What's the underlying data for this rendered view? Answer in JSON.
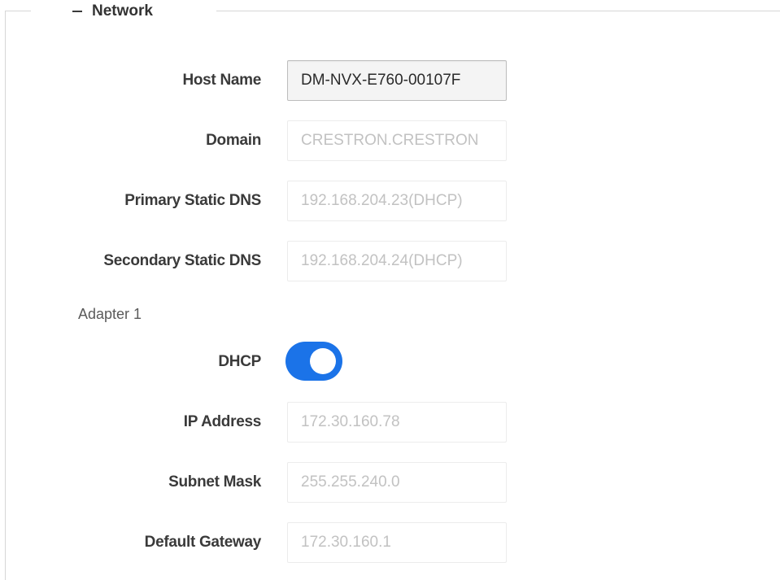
{
  "section": {
    "title": "Network",
    "collapse_icon": "minus-icon"
  },
  "fields": {
    "host_name": {
      "label": "Host Name",
      "value": "DM-NVX-E760-00107F"
    },
    "domain": {
      "label": "Domain",
      "value": "CRESTRON.CRESTRON"
    },
    "primary_dns": {
      "label": "Primary Static DNS",
      "value": "192.168.204.23(DHCP)"
    },
    "secondary_dns": {
      "label": "Secondary Static DNS",
      "value": "192.168.204.24(DHCP)"
    }
  },
  "adapter": {
    "title": "Adapter 1",
    "dhcp": {
      "label": "DHCP",
      "enabled": true
    },
    "ip_address": {
      "label": "IP Address",
      "value": "172.30.160.78"
    },
    "subnet_mask": {
      "label": "Subnet Mask",
      "value": "255.255.240.0"
    },
    "default_gateway": {
      "label": "Default Gateway",
      "value": "172.30.160.1"
    }
  },
  "colors": {
    "toggle_on": "#1b73e8",
    "frame_border": "#d6d6d6",
    "disabled_text": "#c2c2c2",
    "label_text": "#3a3a3a"
  }
}
